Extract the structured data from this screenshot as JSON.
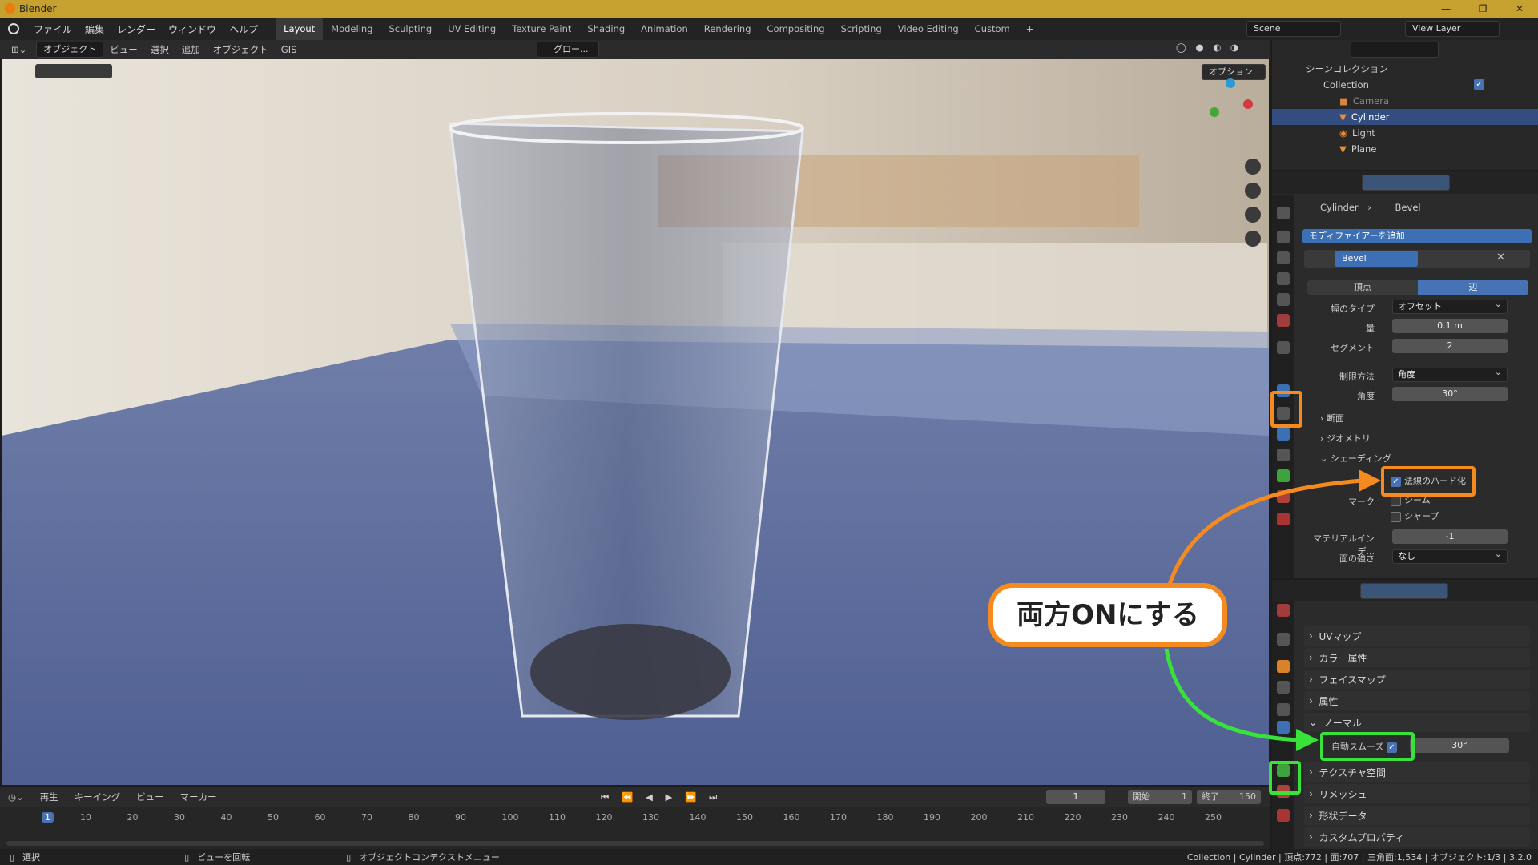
{
  "app": {
    "title": "Blender"
  },
  "menu": [
    "ファイル",
    "編集",
    "レンダー",
    "ウィンドウ",
    "ヘルプ"
  ],
  "workspaces": [
    "Layout",
    "Modeling",
    "Sculpting",
    "UV Editing",
    "Texture Paint",
    "Shading",
    "Animation",
    "Rendering",
    "Compositing",
    "Scripting",
    "Video Editing",
    "Custom"
  ],
  "active_workspace": "Layout",
  "scene": "Scene",
  "view_layer": "View Layer",
  "viewport_header": {
    "mode": "オブジェクト",
    "items": [
      "ビュー",
      "選択",
      "追加",
      "オブジェクト",
      "GIS"
    ],
    "transform": "グロー..."
  },
  "viewport": {
    "options_label": "オプション"
  },
  "outliner": {
    "root": "シーンコレクション",
    "collection": "Collection",
    "items": [
      {
        "name": "Camera",
        "icon": "camera-icon"
      },
      {
        "name": "Cylinder",
        "icon": "mesh-icon",
        "selected": true
      },
      {
        "name": "Light",
        "icon": "light-icon"
      },
      {
        "name": "Plane",
        "icon": "mesh-icon"
      }
    ]
  },
  "properties": {
    "breadcrumb_object": "Cylinder",
    "breadcrumb_modifier": "Bevel",
    "add_modifier": "モディファイアーを追加",
    "modifier_name": "Bevel",
    "affect_vertices": "頂点",
    "affect_edges": "辺",
    "width_type_label": "幅のタイプ",
    "width_type": "オフセット",
    "amount_label": "量",
    "amount": "0.1 m",
    "segments_label": "セグメント",
    "segments": "2",
    "limit_method_label": "制限方法",
    "limit_method": "角度",
    "angle_label": "角度",
    "angle": "30°",
    "profile": "断面",
    "geometry": "ジオメトリ",
    "shading": "シェーディング",
    "harden_normals": "法線のハード化",
    "mark_label": "マーク",
    "seam": "シーム",
    "sharp": "シャープ",
    "material_index_label": "マテリアルインデ...",
    "material_index": "-1",
    "face_strength_label": "面の強さ",
    "face_strength": "なし"
  },
  "data_props": {
    "panels": [
      "UVマップ",
      "カラー属性",
      "フェイスマップ",
      "属性",
      "ノーマル"
    ],
    "auto_smooth": "自動スムーズ",
    "auto_smooth_angle": "30°",
    "panels_after": [
      "テクスチャ空間",
      "リメッシュ",
      "形状データ",
      "カスタムプロパティ"
    ]
  },
  "callout": "両方ONにする",
  "timeline": {
    "menu": [
      "再生",
      "キーイング",
      "ビュー",
      "マーカー"
    ],
    "current_frame": "1",
    "start_label": "開始",
    "start": "1",
    "end_label": "終了",
    "end": "150",
    "ticks": [
      "1",
      "10",
      "20",
      "30",
      "40",
      "50",
      "60",
      "70",
      "80",
      "90",
      "100",
      "110",
      "120",
      "130",
      "140",
      "150",
      "160",
      "170",
      "180",
      "190",
      "200",
      "210",
      "220",
      "230",
      "240",
      "250"
    ]
  },
  "status": {
    "left": "選択",
    "middle": "ビューを回転",
    "right_ctx": "オブジェクトコンテクストメニュー",
    "stats": "Collection | Cylinder | 頂点:772 | 面:707 | 三角面:1,534 | オブジェクト:1/3 | 3.2.0"
  },
  "colors": {
    "accent_orange": "#f58a1f",
    "accent_green": "#39e23a",
    "select_blue": "#4772b3"
  }
}
